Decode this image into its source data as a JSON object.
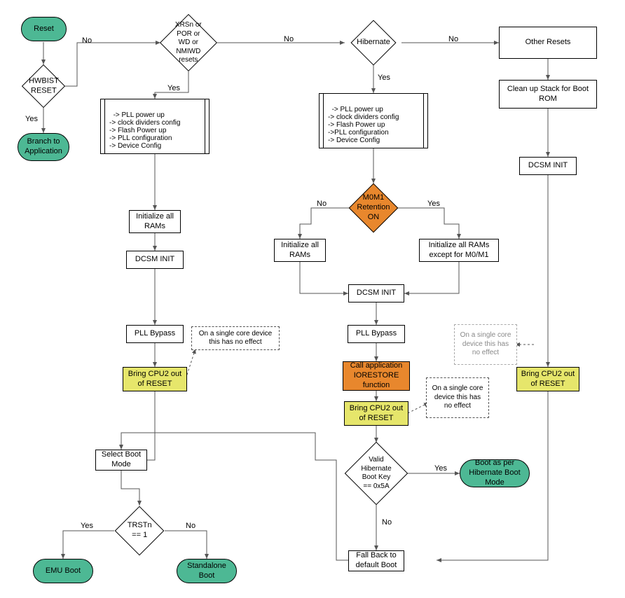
{
  "nodes": {
    "reset": "Reset",
    "hwbist": "HWBIST RESET",
    "branch_app": "Branch to Application",
    "xrsn": "XRSn or POR or WD or NMIWD resets",
    "hibernate": "Hibernate",
    "other_resets": "Other Resets",
    "cleanup_stack": "Clean up Stack for Boot ROM",
    "pll_cfg_left": "-> PLL power up\n-> clock dividers config\n-> Flash Power up\n-> PLL configuration\n-> Device Config",
    "pll_cfg_mid": "-> PLL power up\n-> clock dividers config\n-> Flash Power up\n->PLL configuration\n-> Device Config",
    "init_rams_left": "Initialize all RAMs",
    "dcsm_left": "DCSM INIT",
    "pll_bypass_left": "PLL Bypass",
    "cpu2_left": "Bring CPU2 out of RESET",
    "note_left": "On a single core device this has no effect",
    "m0m1": "M0M1 Retention ON",
    "init_rams_mid": "Initialize all RAMs",
    "init_rams_except": "Initialize all RAMs except for M0/M1",
    "dcsm_mid": "DCSM INIT",
    "pll_bypass_mid": "PLL Bypass",
    "iorestore": "Call application IORESTORE function",
    "cpu2_mid": "Bring CPU2 out of RESET",
    "note_mid": "On a single core device this has no effect",
    "note_right": "On a single core device this has no effect",
    "dcsm_right": "DCSM INIT",
    "cpu2_right": "Bring CPU2 out of RESET",
    "select_boot": "Select Boot Mode",
    "trstn": "TRSTn == 1",
    "emu_boot": "EMU Boot",
    "standalone_boot": "Standalone Boot",
    "valid_hib": "Valid Hibernate Boot Key == 0x5A",
    "boot_per_hib": "Boot as per Hibernate Boot Mode",
    "fallback": "Fall Back to default Boot"
  },
  "labels": {
    "yes": "Yes",
    "no": "No"
  }
}
